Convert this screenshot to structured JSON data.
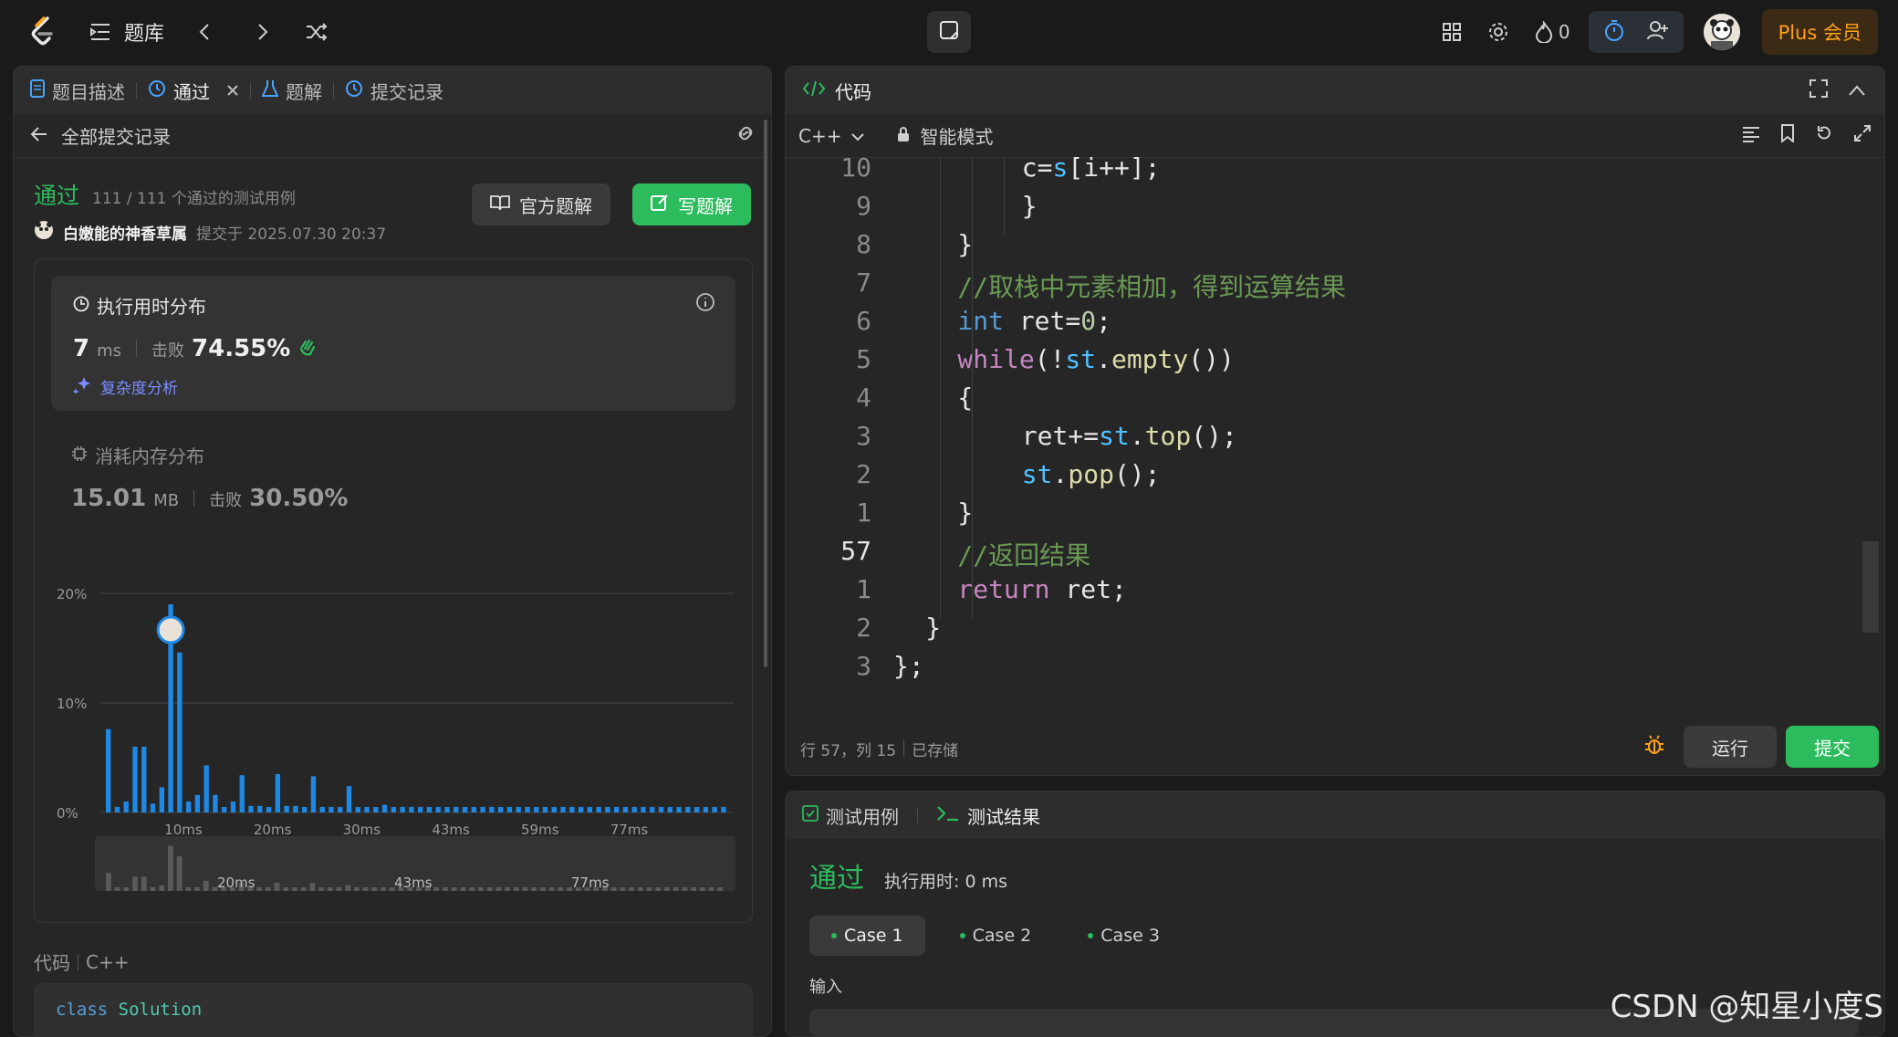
{
  "topbar": {
    "problems_label": "题库",
    "flame_count": "0",
    "plus_label": "Plus 会员"
  },
  "left": {
    "tabs": [
      {
        "label": "题目描述"
      },
      {
        "label": "通过"
      },
      {
        "label": "题解"
      },
      {
        "label": "提交记录"
      }
    ],
    "back_label": "全部提交记录",
    "status": "通过",
    "testcases": "111 / 111 个通过的测试用例",
    "username": "白嫩能的神香草属",
    "submitted_at": "提交于 2025.07.30 20:37",
    "official_solution": "官方题解",
    "write_solution": "写题解",
    "runtime": {
      "title": "执行用时分布",
      "value": "7",
      "unit": "ms",
      "beats_label": "击败",
      "beats": "74.55%",
      "complexity": "复杂度分析"
    },
    "memory": {
      "title": "消耗内存分布",
      "value": "15.01",
      "unit": "MB",
      "beats_label": "击败",
      "beats": "30.50%"
    },
    "code_label": "代码",
    "code_lang": "C++",
    "code_preview": "class Solution",
    "code_preview_kw": "class",
    "code_preview_name": "Solution"
  },
  "chart_data": {
    "type": "bar",
    "y_ticks": [
      "20%",
      "10%",
      "0%"
    ],
    "ylim": [
      0,
      20
    ],
    "x_ticks": [
      "10ms",
      "20ms",
      "30ms",
      "43ms",
      "59ms",
      "77ms"
    ],
    "nav_ticks": [
      "20ms",
      "43ms",
      "77ms"
    ],
    "values": [
      7.6,
      0.5,
      1,
      6,
      6,
      0.8,
      2.3,
      19,
      14.6,
      1,
      1.6,
      4.3,
      1.6,
      0.5,
      1,
      3.4,
      0.6,
      0.6,
      0.5,
      3.5,
      0.6,
      0.6,
      0.5,
      3.3,
      0.5,
      0.5,
      0.5,
      2.4,
      0.5,
      0.5,
      0.5,
      0.7,
      0.5,
      0.5,
      0.5,
      0.5,
      0.5,
      0.5,
      0.5,
      0.5,
      0.5,
      0.5,
      0.5,
      0.5,
      0.5,
      0.5,
      0.5,
      0.5,
      0.5,
      0.5,
      0.5,
      0.5,
      0.5,
      0.5,
      0.5,
      0.5,
      0.5,
      0.5,
      0.5,
      0.5,
      0.5,
      0.5,
      0.5,
      0.5,
      0.5,
      0.5,
      0.5,
      0.5,
      0.5,
      0.5
    ],
    "highlight_index": 7,
    "bar_color": "#1e88e5"
  },
  "right": {
    "code_title": "代码",
    "lang": "C++",
    "mode": "智能模式",
    "lines": [
      {
        "num": "10",
        "indent": 8,
        "parts": [
          [
            "",
            "c="
          ],
          [
            "var",
            "s"
          ],
          [
            "",
            "[i++];"
          ]
        ]
      },
      {
        "num": "9",
        "indent": 8,
        "parts": [
          [
            "",
            "}"
          ]
        ]
      },
      {
        "num": "8",
        "indent": 4,
        "parts": [
          [
            "",
            "}"
          ]
        ]
      },
      {
        "num": "7",
        "indent": 4,
        "parts": [
          [
            "cm",
            "//取栈中元素相加，得到运算结果"
          ]
        ]
      },
      {
        "num": "6",
        "indent": 4,
        "parts": [
          [
            "ty",
            "int"
          ],
          [
            "",
            " ret="
          ],
          [
            "num",
            "0"
          ],
          [
            "",
            ";"
          ]
        ]
      },
      {
        "num": "5",
        "indent": 4,
        "parts": [
          [
            "kw",
            "while"
          ],
          [
            "",
            "(!"
          ],
          [
            "var",
            "st"
          ],
          [
            "",
            "."
          ],
          [
            "fn",
            "empty"
          ],
          [
            "",
            "())"
          ]
        ]
      },
      {
        "num": "4",
        "indent": 4,
        "parts": [
          [
            "",
            "{"
          ]
        ]
      },
      {
        "num": "3",
        "indent": 8,
        "parts": [
          [
            "",
            "ret+="
          ],
          [
            "var",
            "st"
          ],
          [
            "",
            "."
          ],
          [
            "fn",
            "top"
          ],
          [
            "",
            "();"
          ]
        ]
      },
      {
        "num": "2",
        "indent": 8,
        "parts": [
          [
            "var",
            "st"
          ],
          [
            "",
            "."
          ],
          [
            "fn",
            "pop"
          ],
          [
            "",
            "();"
          ]
        ]
      },
      {
        "num": "1",
        "indent": 4,
        "parts": [
          [
            "",
            "}"
          ]
        ]
      },
      {
        "num": "57",
        "indent": 4,
        "parts": [
          [
            "cm",
            "//返回结果"
          ]
        ]
      },
      {
        "num": "1",
        "indent": 4,
        "parts": [
          [
            "kw",
            "return"
          ],
          [
            "",
            " ret;"
          ]
        ]
      },
      {
        "num": "2",
        "indent": 2,
        "parts": [
          [
            "",
            "}"
          ]
        ]
      },
      {
        "num": "3",
        "indent": 0,
        "parts": [
          [
            "",
            "};"
          ]
        ]
      }
    ],
    "current_line": "57",
    "cursor_pos": "行 57，列 15",
    "saved": "已存储",
    "run_label": "运行",
    "submit_label": "提交"
  },
  "bottom": {
    "tab_testcase": "测试用例",
    "tab_result": "测试结果",
    "status": "通过",
    "runtime": "执行用时: 0 ms",
    "cases": [
      "Case 1",
      "Case 2",
      "Case 3"
    ],
    "input_label": "输入"
  },
  "watermark": "CSDN @知星小度S"
}
